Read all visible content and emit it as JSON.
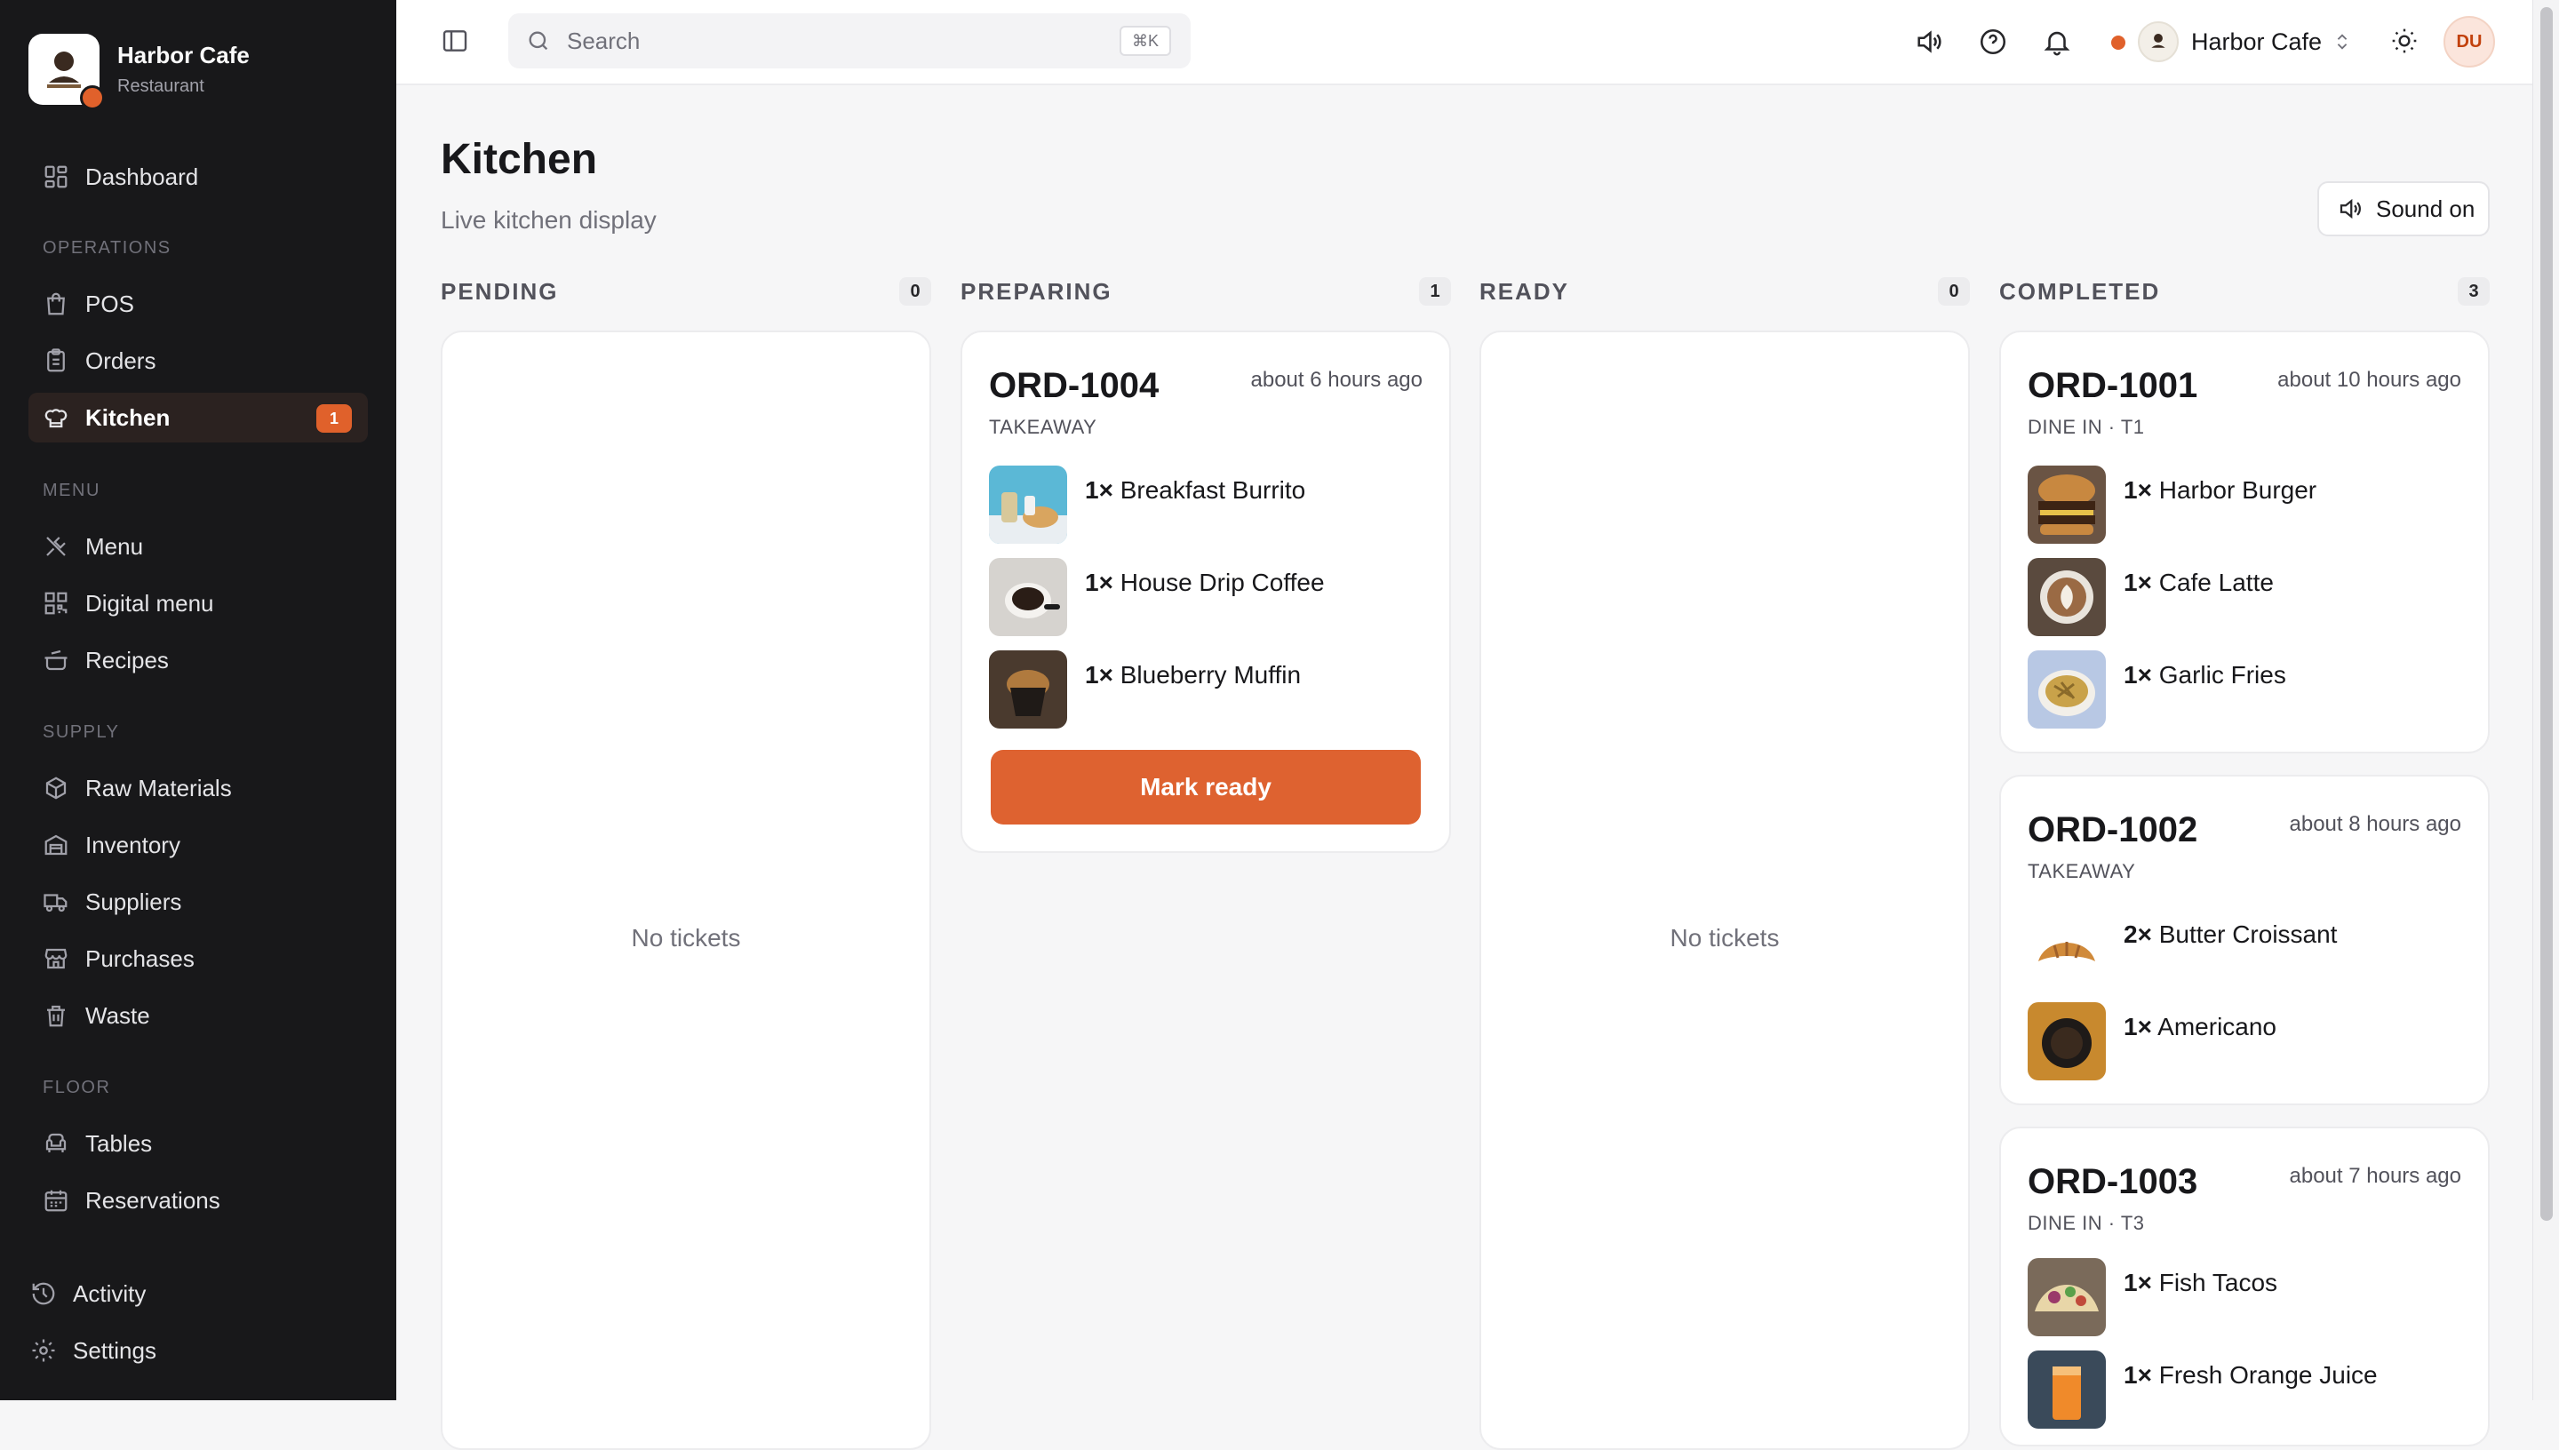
{
  "brand": {
    "name": "Harbor Cafe",
    "subtitle": "Restaurant"
  },
  "nav": {
    "dashboard": "Dashboard",
    "sections": {
      "operations": "OPERATIONS",
      "menu": "MENU",
      "supply": "SUPPLY",
      "floor": "FLOOR"
    },
    "pos": "POS",
    "orders": "Orders",
    "kitchen": "Kitchen",
    "kitchen_badge": "1",
    "menu": "Menu",
    "digital_menu": "Digital menu",
    "recipes": "Recipes",
    "raw_materials": "Raw Materials",
    "inventory": "Inventory",
    "suppliers": "Suppliers",
    "purchases": "Purchases",
    "waste": "Waste",
    "tables": "Tables",
    "reservations": "Reservations",
    "activity": "Activity",
    "settings": "Settings"
  },
  "topbar": {
    "search_placeholder": "Search",
    "search_shortcut": "⌘K",
    "org_name": "Harbor Cafe",
    "user_initials": "DU"
  },
  "page": {
    "title": "Kitchen",
    "subtitle": "Live kitchen display",
    "sound_label": "Sound on"
  },
  "columns": {
    "pending": {
      "title": "PENDING",
      "count": "0",
      "empty": "No tickets"
    },
    "preparing": {
      "title": "PREPARING",
      "count": "1"
    },
    "ready": {
      "title": "READY",
      "count": "0",
      "empty": "No tickets"
    },
    "completed": {
      "title": "COMPLETED",
      "count": "3"
    }
  },
  "tickets": {
    "ord1004": {
      "id": "ORD-1004",
      "time": "about 6 hours ago",
      "type": "TAKEAWAY",
      "items": [
        {
          "qty": "1×",
          "name": "Breakfast Burrito"
        },
        {
          "qty": "1×",
          "name": "House Drip Coffee"
        },
        {
          "qty": "1×",
          "name": "Blueberry Muffin"
        }
      ],
      "action": "Mark ready"
    },
    "ord1001": {
      "id": "ORD-1001",
      "time": "about 10 hours ago",
      "type": "DINE IN · T1",
      "items": [
        {
          "qty": "1×",
          "name": "Harbor Burger"
        },
        {
          "qty": "1×",
          "name": "Cafe Latte"
        },
        {
          "qty": "1×",
          "name": "Garlic Fries"
        }
      ]
    },
    "ord1002": {
      "id": "ORD-1002",
      "time": "about 8 hours ago",
      "type": "TAKEAWAY",
      "items": [
        {
          "qty": "2×",
          "name": "Butter Croissant"
        },
        {
          "qty": "1×",
          "name": "Americano"
        }
      ]
    },
    "ord1003": {
      "id": "ORD-1003",
      "time": "about 7 hours ago",
      "type": "DINE IN · T3",
      "items": [
        {
          "qty": "1×",
          "name": "Fish Tacos"
        },
        {
          "qty": "1×",
          "name": "Fresh Orange Juice"
        }
      ]
    }
  },
  "colors": {
    "accent": "#de6230",
    "sidebar_bg": "#18181a",
    "page_bg": "#f6f6f7"
  }
}
